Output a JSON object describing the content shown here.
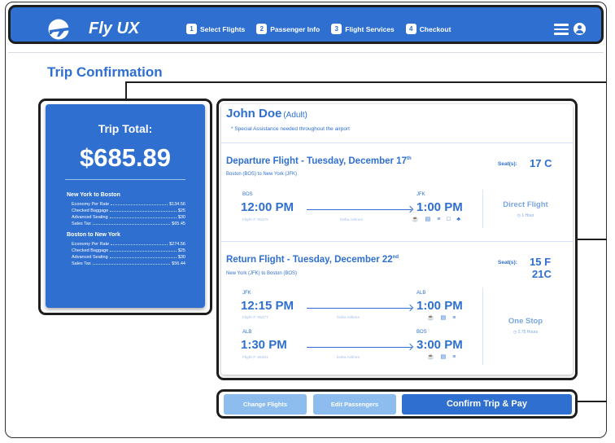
{
  "app": {
    "brand": "Fly UX"
  },
  "header": {
    "steps": [
      {
        "num": "1",
        "label": "Select Flights"
      },
      {
        "num": "2",
        "label": "Passenger Info"
      },
      {
        "num": "3",
        "label": "Flight Services"
      },
      {
        "num": "4",
        "label": "Checkout"
      }
    ]
  },
  "page": {
    "title": "Trip Confirmation"
  },
  "summary": {
    "label": "Trip Total:",
    "total": "$685.89",
    "legs": [
      {
        "title": "New York to Boston",
        "lines": [
          {
            "label": "Economy Per Rate",
            "value": "$134.56"
          },
          {
            "label": "Checked Baggage",
            "value": "$25"
          },
          {
            "label": "Advanced Seating",
            "value": "$30"
          },
          {
            "label": "Sales Tax",
            "value": "$65.45"
          }
        ]
      },
      {
        "title": "Boston to New York",
        "lines": [
          {
            "label": "Economy Per Rate",
            "value": "$274.56"
          },
          {
            "label": "Checked Baggage",
            "value": "$25"
          },
          {
            "label": "Advanced Seating",
            "value": "$30"
          },
          {
            "label": "Sales Tax",
            "value": "$56.44"
          }
        ]
      }
    ]
  },
  "passenger": {
    "name": "John Doe",
    "type": "(Adult)",
    "note": "* Special Assistance needed throughout the airport"
  },
  "departure": {
    "title": "Departure Flight - Tuesday, December 17",
    "title_sup": "th",
    "route": "Boston (BOS) to New York (JFK)",
    "seat_label": "Seat(s):",
    "seat": "17 C",
    "from_code": "BOS",
    "from_time": "12:00 PM",
    "to_code": "JFK",
    "to_time": "1:00 PM",
    "flight_no": "Flight #: 65475",
    "airline": "Delta Airlines",
    "stop_type": "Direct Flight",
    "duration": "◷ 1 Hour"
  },
  "return": {
    "title": "Return Flight - Tuesday, December 22",
    "title_sup": "nd",
    "route": "New York (JFK) to Boston (BOS)",
    "seat_label": "Seat(s):",
    "seat1": "15 F",
    "seat2": "21C",
    "seg1": {
      "from_code": "JFK",
      "from_time": "12:15 PM",
      "to_code": "ALB",
      "to_time": "1:00 PM",
      "flight_no": "Flight #: 65477",
      "airline": "Delta Airlines"
    },
    "seg2": {
      "from_code": "ALB",
      "from_time": "1:30 PM",
      "to_code": "BOS",
      "to_time": "3:00 PM",
      "flight_no": "Flight #: 65481",
      "airline": "Delta Airlines"
    },
    "stop_type": "One Stop",
    "duration": "◷ 2.75 Hours"
  },
  "amenities": "☕ ▤ ≡ □ ♣",
  "amenities_short": "☕ ▤ ≡",
  "actions": {
    "change_flights": "Change Flights",
    "edit_passengers": "Edit Passengers",
    "confirm": "Confirm Trip & Pay"
  }
}
